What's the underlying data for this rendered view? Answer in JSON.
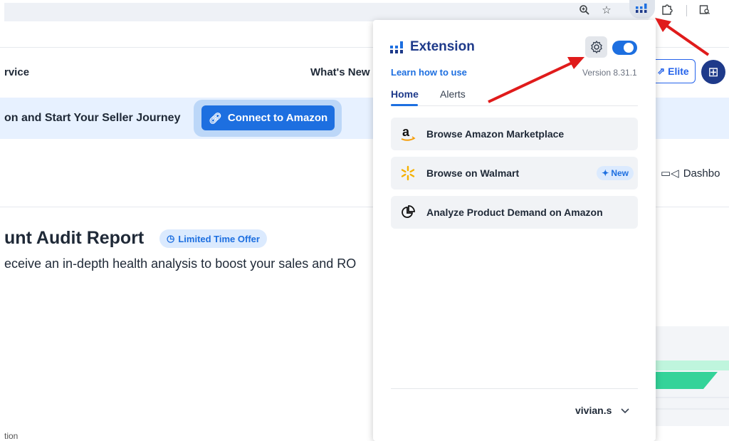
{
  "browser": {
    "zoom_icon": "zoom-in-icon",
    "star_icon": "star-icon",
    "extension_icon": "extension-bars-icon",
    "puzzle_icon": "extensions-puzzle-icon",
    "tabsearch_icon": "tab-search-icon"
  },
  "background_page": {
    "nav_service": "rvice",
    "nav_whats_new": "What's New",
    "elite_label": "Elite",
    "banner_text": "on and Start Your Seller Journey",
    "connect_label": "Connect to Amazon",
    "dashboard_label": "Dashbo",
    "audit_title": "unt Audit Report",
    "offer_label": "Limited Time Offer",
    "description": "eceive an in-depth health analysis to boost your sales and RO",
    "footer_text": "tion"
  },
  "popup": {
    "title": "Extension",
    "learn_link": "Learn how to use",
    "version": "Version 8.31.1",
    "tabs": [
      {
        "label": "Home",
        "active": true
      },
      {
        "label": "Alerts",
        "active": false
      }
    ],
    "cards": [
      {
        "label": "Browse Amazon Marketplace",
        "icon": "amazon-icon"
      },
      {
        "label": "Browse on Walmart",
        "icon": "walmart-spark-icon",
        "badge": "New"
      },
      {
        "label": "Analyze Product Demand on Amazon",
        "icon": "pie-chart-icon"
      }
    ],
    "toggle_on": true,
    "user": "vivian.s"
  },
  "colors": {
    "accent": "#1d6fe0",
    "navy": "#1e3a8a",
    "arrow": "#e01b1b"
  }
}
